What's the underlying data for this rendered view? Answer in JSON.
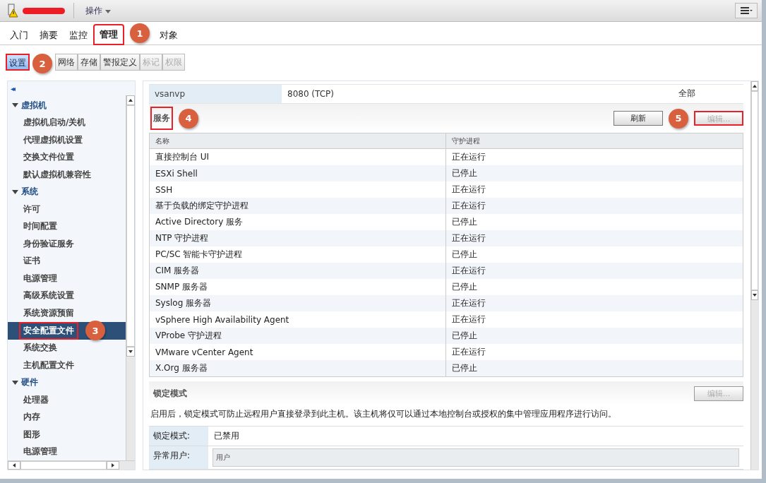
{
  "header": {
    "action_menu": "操作"
  },
  "tabs": [
    {
      "label": "入门",
      "selected": false
    },
    {
      "label": "摘要",
      "selected": false
    },
    {
      "label": "监控",
      "selected": false
    },
    {
      "label": "管理",
      "selected": true,
      "callout": "1"
    },
    {
      "label": "对象",
      "selected": false
    }
  ],
  "subtabs": [
    {
      "label": "设置",
      "selected": true,
      "disabled": false,
      "callout": "2"
    },
    {
      "label": "网络",
      "selected": false,
      "disabled": false
    },
    {
      "label": "存储",
      "selected": false,
      "disabled": false
    },
    {
      "label": "警报定义",
      "selected": false,
      "disabled": false
    },
    {
      "label": "标记",
      "selected": false,
      "disabled": true
    },
    {
      "label": "权限",
      "selected": false,
      "disabled": true
    }
  ],
  "sidebar": {
    "collapse": "◂◂",
    "groups": [
      {
        "label": "虚拟机",
        "expanded": true,
        "children": [
          {
            "label": "虚拟机启动/关机",
            "selected": false
          },
          {
            "label": "代理虚拟机设置",
            "selected": false
          },
          {
            "label": "交换文件位置",
            "selected": false
          },
          {
            "label": "默认虚拟机兼容性",
            "selected": false
          }
        ]
      },
      {
        "label": "系统",
        "expanded": true,
        "children": [
          {
            "label": "许可",
            "selected": false
          },
          {
            "label": "时间配置",
            "selected": false
          },
          {
            "label": "身份验证服务",
            "selected": false
          },
          {
            "label": "证书",
            "selected": false
          },
          {
            "label": "电源管理",
            "selected": false
          },
          {
            "label": "高级系统设置",
            "selected": false
          },
          {
            "label": "系统资源预留",
            "selected": false
          },
          {
            "label": "安全配置文件",
            "selected": true,
            "callout": "3"
          },
          {
            "label": "系统交换",
            "selected": false
          },
          {
            "label": "主机配置文件",
            "selected": false
          }
        ]
      },
      {
        "label": "硬件",
        "expanded": true,
        "children": [
          {
            "label": "处理器",
            "selected": false
          },
          {
            "label": "内存",
            "selected": false
          },
          {
            "label": "图形",
            "selected": false
          },
          {
            "label": "电源管理",
            "selected": false
          }
        ]
      }
    ]
  },
  "firewall_row": [
    "vsanvp",
    "8080 (TCP)",
    "全部"
  ],
  "services": {
    "title": "服务",
    "title_callout": "4",
    "refresh": "刷新",
    "edit": {
      "label": "编辑...",
      "disabled": true,
      "callout": "5"
    },
    "columns": [
      "名称",
      "守护进程"
    ],
    "rows": [
      [
        "直接控制台 UI",
        "正在运行"
      ],
      [
        "ESXi Shell",
        "已停止"
      ],
      [
        "SSH",
        "正在运行"
      ],
      [
        "基于负载的绑定守护进程",
        "正在运行"
      ],
      [
        "Active Directory 服务",
        "已停止"
      ],
      [
        "NTP 守护进程",
        "正在运行"
      ],
      [
        "PC/SC 智能卡守护进程",
        "已停止"
      ],
      [
        "CIM 服务器",
        "正在运行"
      ],
      [
        "SNMP 服务器",
        "已停止"
      ],
      [
        "Syslog 服务器",
        "正在运行"
      ],
      [
        "vSphere High Availability Agent",
        "正在运行"
      ],
      [
        "VProbe 守护进程",
        "已停止"
      ],
      [
        "VMware vCenter Agent",
        "正在运行"
      ],
      [
        "X.Org 服务器",
        "已停止"
      ]
    ]
  },
  "lockdown": {
    "title": "锁定模式",
    "edit": {
      "label": "编辑...",
      "disabled": true
    },
    "description": "启用后，锁定模式可防止远程用户直接登录到此主机。该主机将仅可以通过本地控制台或授权的集中管理应用程序进行访问。",
    "fields": [
      {
        "label": "锁定模式:",
        "value": "已禁用"
      },
      {
        "label": "异常用户:",
        "column": "用户"
      }
    ]
  }
}
